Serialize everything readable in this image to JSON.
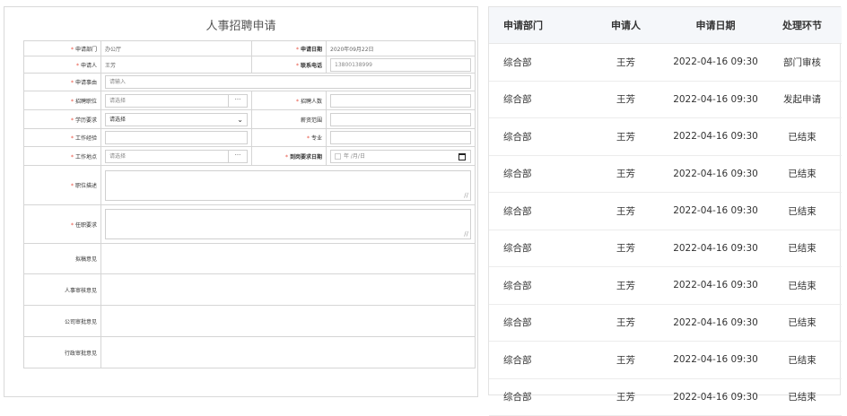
{
  "form": {
    "title": "人事招聘申请",
    "fields": {
      "dept_label": "申请部门",
      "dept_value": "办公厅",
      "date_label": "申请日期",
      "date_value": "2020年09月22日",
      "applicant_label": "申请人",
      "applicant_value": "王芳",
      "phone_label": "联系电话",
      "phone_value": "13800138999",
      "reason_label": "申请事由",
      "reason_placeholder": "请输入",
      "position_label": "招聘职位",
      "position_placeholder": "请选择",
      "count_label": "招聘人数",
      "edu_label": "学历要求",
      "edu_selected": "请选择",
      "salary_label": "薪资范围",
      "exp_label": "工作经验",
      "major_label": "专业",
      "location_label": "工作地点",
      "location_placeholder": "请选择",
      "arrival_label": "到岗要求日期",
      "arrival_placeholder": "年 /月/日",
      "desc_label": "职位描述",
      "duty_label": "任职要求",
      "proposal_label": "拟稿意见",
      "hr_label": "人事审核意见",
      "company_label": "公司审批意见",
      "admin_label": "行政审批意见"
    },
    "browse_btn": "···"
  },
  "list": {
    "headers": [
      "申请部门",
      "申请人",
      "申请日期",
      "处理环节"
    ],
    "rows": [
      [
        "综合部",
        "王芳",
        "2022-04-16 09:30",
        "部门审核"
      ],
      [
        "综合部",
        "王芳",
        "2022-04-16 09:30",
        "发起申请"
      ],
      [
        "综合部",
        "王芳",
        "2022-04-16 09:30",
        "已结束"
      ],
      [
        "综合部",
        "王芳",
        "2022-04-16 09:30",
        "已结束"
      ],
      [
        "综合部",
        "王芳",
        "2022-04-16 09:30",
        "已结束"
      ],
      [
        "综合部",
        "王芳",
        "2022-04-16 09:30",
        "已结束"
      ],
      [
        "综合部",
        "王芳",
        "2022-04-16 09:30",
        "已结束"
      ],
      [
        "综合部",
        "王芳",
        "2022-04-16 09:30",
        "已结束"
      ],
      [
        "综合部",
        "王芳",
        "2022-04-16 09:30",
        "已结束"
      ],
      [
        "综合部",
        "王芳",
        "2022-04-16 09:30",
        "已结束"
      ]
    ]
  },
  "colors": {
    "required": "#e74c3c",
    "header_bg": "#f5f7fa",
    "border": "#d5d5d5"
  }
}
